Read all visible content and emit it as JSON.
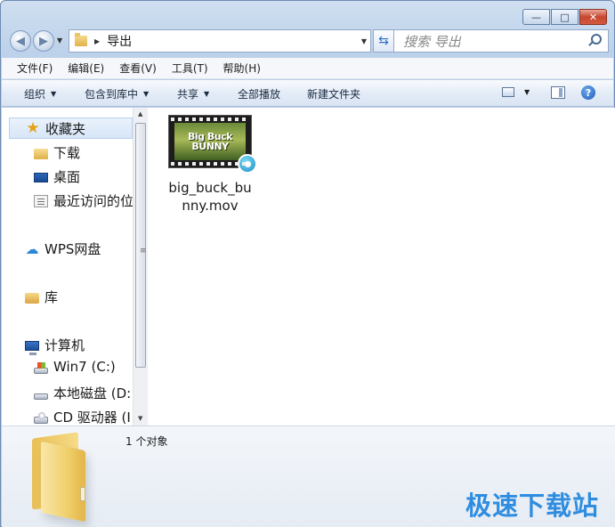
{
  "window": {
    "caption_buttons": {
      "minimize": "▭",
      "maximize": "□",
      "close": "✕"
    }
  },
  "nav": {
    "back_icon": "back-arrow-icon",
    "forward_icon": "forward-arrow-icon",
    "address_path": "导出",
    "search_placeholder": "搜索 导出"
  },
  "menubar": {
    "items": [
      "文件(F)",
      "编辑(E)",
      "查看(V)",
      "工具(T)",
      "帮助(H)"
    ]
  },
  "commandbar": {
    "organize": "组织",
    "include_in_library": "包含到库中",
    "share": "共享",
    "play_all": "全部播放",
    "new_folder": "新建文件夹",
    "help": "?"
  },
  "navpane": {
    "favorites": "收藏夹",
    "downloads": "下载",
    "desktop": "桌面",
    "recent": "最近访问的位",
    "wps": "WPS网盘",
    "libraries": "库",
    "computer": "计算机",
    "drive_c": "Win7 (C:)",
    "drive_d": "本地磁盘 (D:",
    "drive_cd": "CD 驱动器 (I"
  },
  "content": {
    "files": [
      {
        "name": "big_buck_bunny.mov",
        "thumb_line1": "Big Buck",
        "thumb_line2": "BUNNY"
      }
    ]
  },
  "details": {
    "status": "1 个对象",
    "watermark": "极速下载站"
  },
  "colors": {
    "accent": "#2f8de0",
    "titlebar": "#cfdff0",
    "close_button": "#c7462f"
  }
}
